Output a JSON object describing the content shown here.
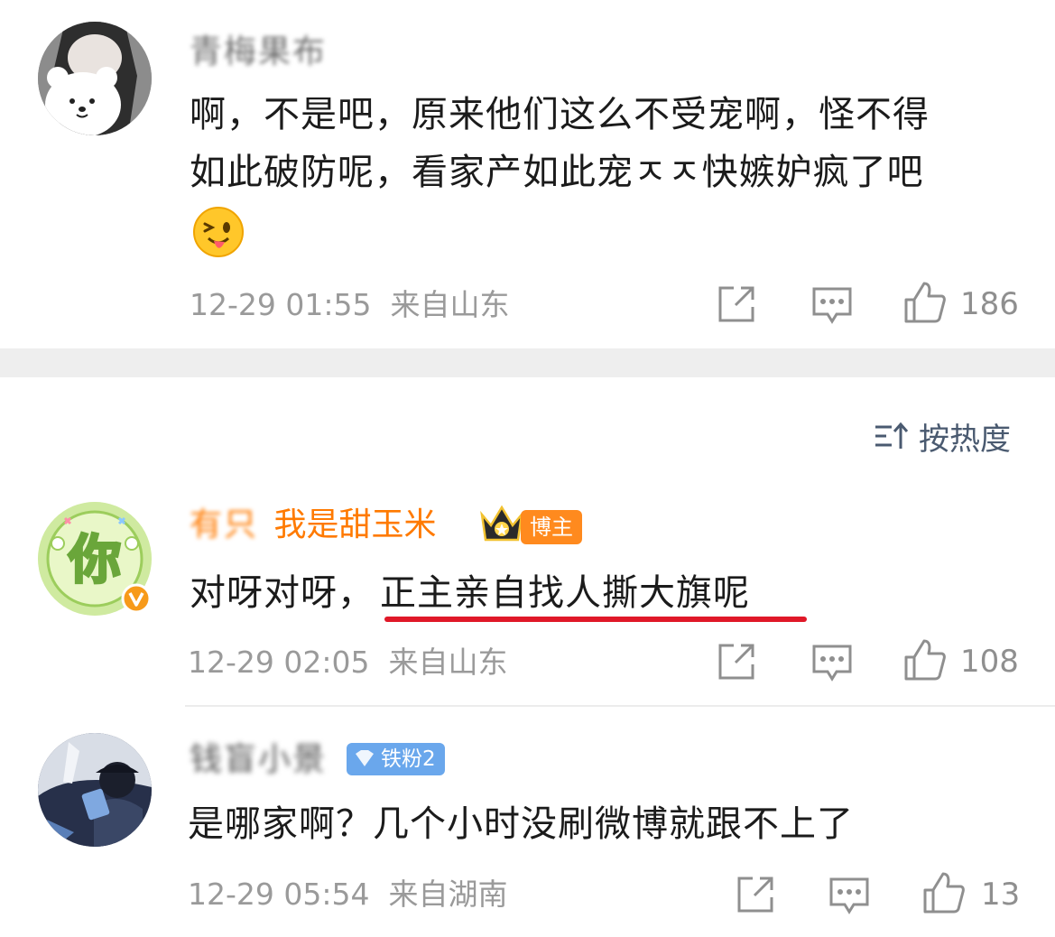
{
  "comments": [
    {
      "username": "青梅果布",
      "text_lines": [
        "啊，不是吧，原来他们这么不受宠啊，怪不得",
        "如此破防呢，看家产如此宠ㅈㅈ快嫉妒疯了吧"
      ],
      "emoji": "😜",
      "time": "12-29 01:55",
      "location": "来自山东",
      "likes": "186"
    },
    {
      "username_prefix": "有只",
      "username": "我是甜玉米",
      "badge": "博主",
      "text_plain": "对呀对呀，",
      "text_highlight": "正主亲自找人撕大旗呢",
      "time": "12-29 02:05",
      "location": "来自山东",
      "likes": "108",
      "avatar_text": "你"
    },
    {
      "username": "钱盲小景",
      "badge": "铁粉2",
      "text": "是哪家啊？几个小时没刷微博就跟不上了",
      "time": "12-29 05:54",
      "location": "来自湖南",
      "likes": "13"
    }
  ],
  "sort": {
    "label": "按热度"
  },
  "colors": {
    "accent_orange": "#ff7a00",
    "underline_red": "#e01828",
    "meta_gray": "#9a9a9a"
  },
  "icons": [
    "share-icon",
    "comment-icon",
    "like-icon",
    "sort-icon",
    "crown-icon",
    "verified-icon"
  ]
}
